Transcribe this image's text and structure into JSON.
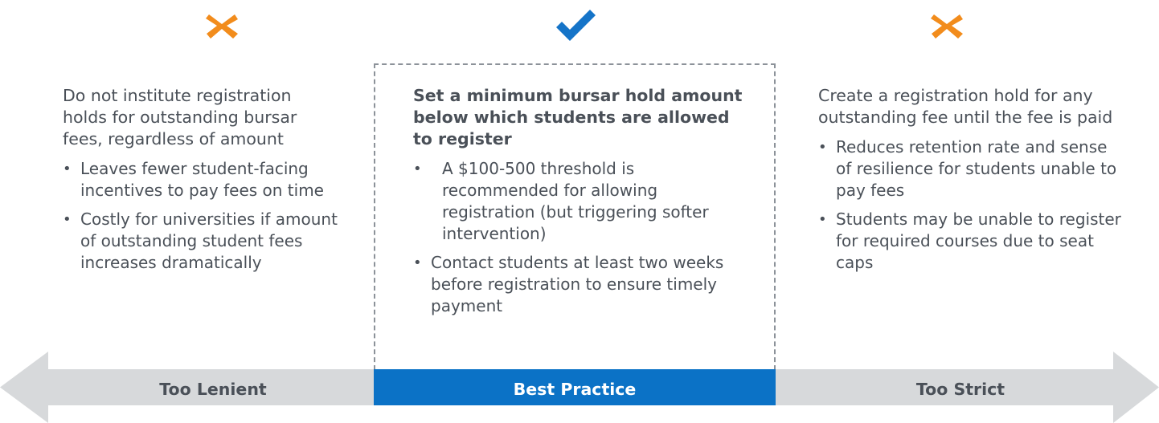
{
  "colors": {
    "cross": "#f28c1c",
    "check": "#1574c8",
    "bar_gray": "#d7d9db",
    "bar_blue": "#0b72c6",
    "text": "#4a5058"
  },
  "left": {
    "icon": "cross-icon",
    "heading": "Do not institute registration holds for outstanding bursar fees, regardless of amount",
    "bullets": [
      "Leaves fewer student-facing incentives to pay fees on time",
      "Costly for universities if amount of outstanding student fees increases dramatically"
    ],
    "bar_label": "Too Lenient"
  },
  "center": {
    "icon": "check-icon",
    "heading": "Set a minimum bursar hold amount below which students are allowed to register",
    "bullets": [
      "A $100-500 threshold is recommended for allowing registration (but triggering softer intervention)",
      "Contact students at least two weeks before registration to ensure timely payment"
    ],
    "bar_label": "Best Practice"
  },
  "right": {
    "icon": "cross-icon",
    "heading": "Create a registration hold for any outstanding fee until the fee is paid",
    "bullets": [
      "Reduces retention rate and sense of resilience for students unable to pay fees",
      "Students may be unable to register for required courses due to seat caps"
    ],
    "bar_label": "Too Strict"
  }
}
